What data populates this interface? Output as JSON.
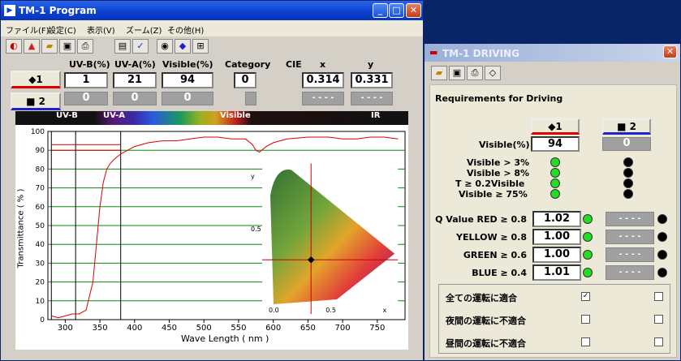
{
  "main": {
    "title": "TM-1 Program",
    "menu": [
      "ファイル(F)",
      "設定(C)",
      "表示(V)",
      "ズーム(Z)",
      "その他(H)"
    ],
    "headers": {
      "uvb": "UV-B(%)",
      "uva": "UV-A(%)",
      "visible": "Visible(%)",
      "category": "Category",
      "cie": "CIE",
      "x": "x",
      "y": "y"
    },
    "row1": {
      "button": "◆1",
      "uvb": "1",
      "uva": "21",
      "visible": "94",
      "category": "0",
      "x": "0.314",
      "y": "0.331"
    },
    "row2": {
      "button": "■ 2",
      "uvb": "0",
      "uva": "0",
      "visible": "0",
      "category": "",
      "x": "- - - -",
      "y": "- - - -"
    },
    "bands": {
      "uvb": "UV-B",
      "uva": "UV-A",
      "visible": "Visible",
      "ir": "IR"
    }
  },
  "chart_data": {
    "type": "line",
    "xlabel": "Wave Length ( nm )",
    "ylabel": "Transmittance ( % )",
    "xlim": [
      275,
      790
    ],
    "ylim": [
      0,
      100
    ],
    "x_ticks": [
      "300",
      "350",
      "400",
      "450",
      "500",
      "550",
      "600",
      "650",
      "700",
      "750"
    ],
    "y_ticks": [
      "0",
      "10",
      "20",
      "30",
      "40",
      "50",
      "60",
      "70",
      "80",
      "90",
      "100"
    ],
    "grid": true,
    "series": [
      {
        "x": [
          280,
          290,
          300,
          310,
          320,
          330,
          340,
          345,
          350,
          355,
          360,
          365,
          370,
          380,
          390,
          400,
          420,
          440,
          460,
          480,
          500,
          520,
          540,
          560,
          570,
          575,
          580,
          590,
          600,
          620,
          650,
          680,
          700,
          720,
          740,
          760,
          780
        ],
        "y": [
          2,
          1,
          2,
          3,
          3,
          5,
          20,
          40,
          60,
          73,
          80,
          83,
          85,
          88,
          90,
          92,
          94,
          95,
          95,
          96,
          97,
          97,
          96,
          96,
          93,
          90,
          89,
          92,
          94,
          96,
          97,
          97,
          96,
          96,
          97,
          97,
          96
        ]
      }
    ],
    "inset": {
      "ticks_x": [
        "0.0",
        "0.5",
        "x"
      ],
      "ticks_y": [
        "0.5",
        "y"
      ],
      "point": {
        "x": 0.314,
        "y": 0.331
      }
    }
  },
  "driving": {
    "title": "TM-1 DRIVING",
    "heading": "Requirements for Driving",
    "btn1": "◆1",
    "btn2": "■ 2",
    "visible_label": "Visible(%)",
    "visible1": "94",
    "visible2": "0",
    "reqs": [
      "Visible > 3%",
      "Visible > 8%",
      "T ≥ 0.2Visible",
      "Visible ≥ 75%"
    ],
    "q": [
      {
        "label": "Q Value RED ≥ 0.8",
        "v1": "1.02",
        "v2": "- - - -"
      },
      {
        "label": "YELLOW ≥ 0.8",
        "v1": "1.00",
        "v2": "- - - -"
      },
      {
        "label": "GREEN ≥ 0.6",
        "v1": "1.00",
        "v2": "- - - -"
      },
      {
        "label": "BLUE ≥ 0.4",
        "v1": "1.01",
        "v2": "- - - -"
      }
    ],
    "checks": [
      {
        "label": "全ての運転に適合",
        "c1": "✓",
        "c2": ""
      },
      {
        "label": "夜間の運転に不適合",
        "c1": "",
        "c2": ""
      },
      {
        "label": "昼間の運転に不適合",
        "c1": "",
        "c2": ""
      }
    ]
  }
}
